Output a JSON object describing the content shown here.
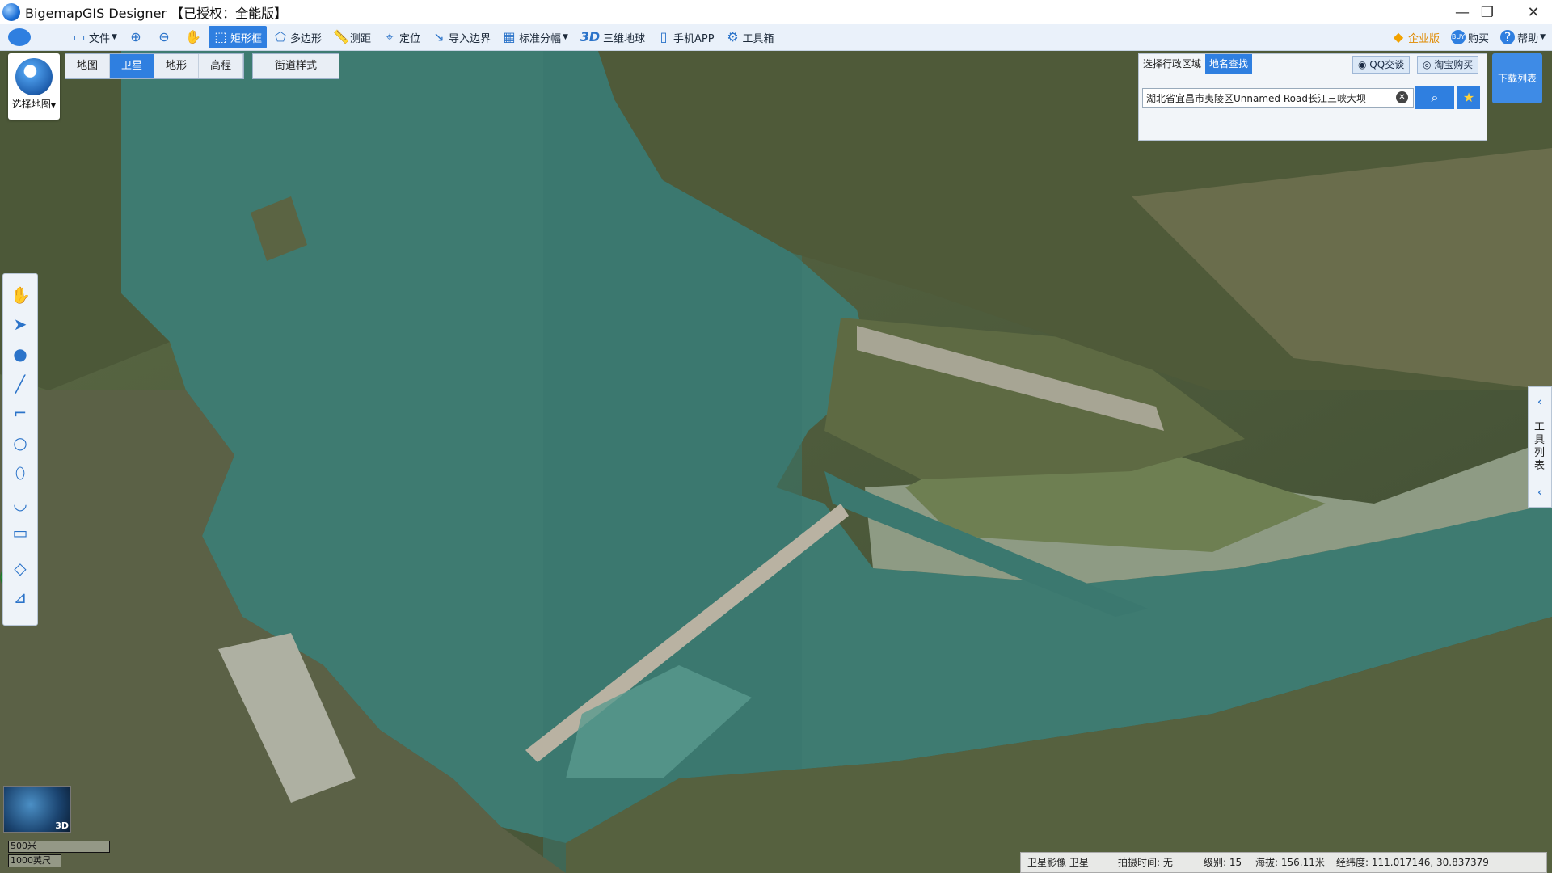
{
  "app": {
    "title": "BigemapGIS Designer 【已授权：全能版】"
  },
  "window": {
    "minimize": "—",
    "restore": "❐",
    "close": "✕"
  },
  "toolbar": {
    "items": [
      {
        "label": "",
        "icon": "app-menu-icon"
      },
      {
        "label": "文件",
        "icon": "folder-icon"
      },
      {
        "label": "",
        "icon": "zoom-in-icon"
      },
      {
        "label": "",
        "icon": "zoom-out-icon"
      },
      {
        "label": "",
        "icon": "pan-hand-icon"
      },
      {
        "label": "矩形框",
        "icon": "rectangle-select-icon",
        "active": true
      },
      {
        "label": "多边形",
        "icon": "polygon-select-icon"
      },
      {
        "label": "测距",
        "icon": "ruler-icon"
      },
      {
        "label": "定位",
        "icon": "location-pin-icon"
      },
      {
        "label": "导入边界",
        "icon": "import-boundary-icon"
      },
      {
        "label": "标准分幅",
        "icon": "grid-icon"
      },
      {
        "label": "三维地球",
        "icon": "3d-globe-icon"
      },
      {
        "label": "手机APP",
        "icon": "phone-icon"
      },
      {
        "label": "工具箱",
        "icon": "gear-icon"
      }
    ],
    "right": [
      {
        "label": "企业版",
        "icon": "diamond-icon"
      },
      {
        "label": "购买",
        "icon": "buy-icon"
      },
      {
        "label": "帮助",
        "icon": "help-icon"
      }
    ]
  },
  "map_type": {
    "label": "选择地图"
  },
  "layers": {
    "tabs": [
      "地图",
      "卫星",
      "地形",
      "高程"
    ],
    "active": "卫星",
    "street_style": "街道样式"
  },
  "search": {
    "tabs": [
      "选择行政区域",
      "地名查找"
    ],
    "active_tab": "地名查找",
    "qq": "QQ交谈",
    "taobao": "淘宝购买",
    "value": "湖北省宜昌市夷陵区Unnamed Road长江三峡大坝"
  },
  "download_list": "下载列表",
  "right_toolbox": {
    "label": "工具列表"
  },
  "minimap": {
    "badge": "3D"
  },
  "scale": {
    "metric": "500米",
    "imperial": "1000英尺"
  },
  "status": {
    "source": "卫星影像 卫星",
    "shot_time": "拍摄时间: 无",
    "level": "级别: 15",
    "altitude": "海拔: 156.11米",
    "coords": "经纬度: 111.017146, 30.837379"
  },
  "colors": {
    "accent": "#2f7fe0",
    "water": "#3d7a70",
    "river": "#8d9a82",
    "land": "#4f5b3a"
  }
}
